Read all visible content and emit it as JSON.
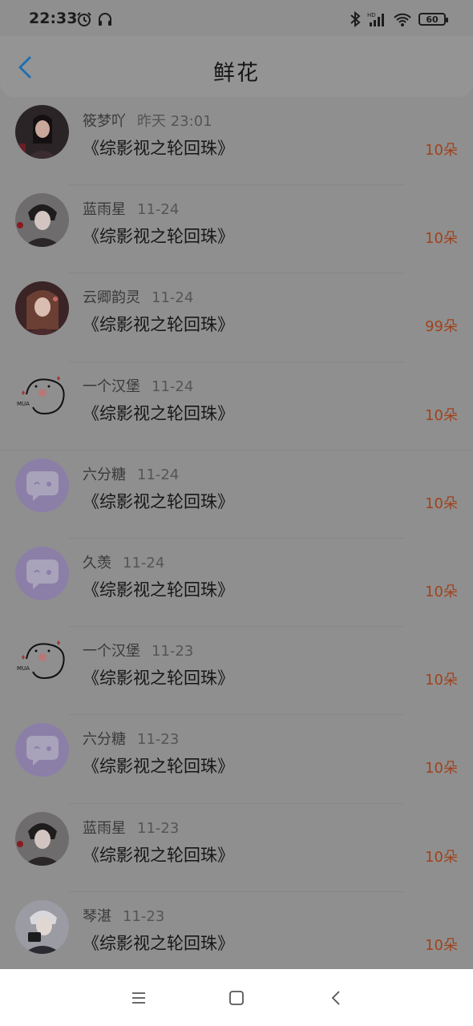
{
  "status": {
    "time": "22:33",
    "battery": "60",
    "hd": "HD"
  },
  "header": {
    "title": "鲜花"
  },
  "rows": [
    {
      "name": "筱梦吖",
      "date": "昨天 23:01",
      "book": "《综影视之轮回珠》",
      "count": "10朵",
      "avatar_icon": "girl-avatar-icon"
    },
    {
      "name": "蓝雨星",
      "date": "11-24",
      "book": "《综影视之轮回珠》",
      "count": "10朵",
      "avatar_icon": "boy-avatar-icon"
    },
    {
      "name": "云卿韵灵",
      "date": "11-24",
      "book": "《综影视之轮回珠》",
      "count": "99朵",
      "avatar_icon": "anime-girl-avatar-icon"
    },
    {
      "name": "一个汉堡",
      "date": "11-24",
      "book": "《综影视之轮回珠》",
      "count": "10朵",
      "avatar_icon": "mua-sticker-avatar-icon",
      "avatar_text": "MUA"
    },
    {
      "name": "六分糖",
      "date": "11-24",
      "book": "《综影视之轮回珠》",
      "count": "10朵",
      "avatar_icon": "chat-bubble-avatar-icon"
    },
    {
      "name": "久羡",
      "date": "11-24",
      "book": "《综影视之轮回珠》",
      "count": "10朵",
      "avatar_icon": "chat-bubble-avatar-icon"
    },
    {
      "name": "一个汉堡",
      "date": "11-23",
      "book": "《综影视之轮回珠》",
      "count": "10朵",
      "avatar_icon": "mua-sticker-avatar-icon",
      "avatar_text": "MUA"
    },
    {
      "name": "六分糖",
      "date": "11-23",
      "book": "《综影视之轮回珠》",
      "count": "10朵",
      "avatar_icon": "chat-bubble-avatar-icon"
    },
    {
      "name": "蓝雨星",
      "date": "11-23",
      "book": "《综影视之轮回珠》",
      "count": "10朵",
      "avatar_icon": "boy-avatar-icon"
    },
    {
      "name": "琴湛",
      "date": "11-23",
      "book": "《综影视之轮回珠》",
      "count": "10朵",
      "avatar_icon": "boy-camera-avatar-icon"
    }
  ],
  "colors": {
    "accent_back": "#1e6fb3",
    "count": "#a0421c",
    "bubble_avatar": "#8b7fa8"
  },
  "navbar": {
    "icons": [
      "menu-icon",
      "home-square-icon",
      "back-triangle-icon"
    ]
  }
}
